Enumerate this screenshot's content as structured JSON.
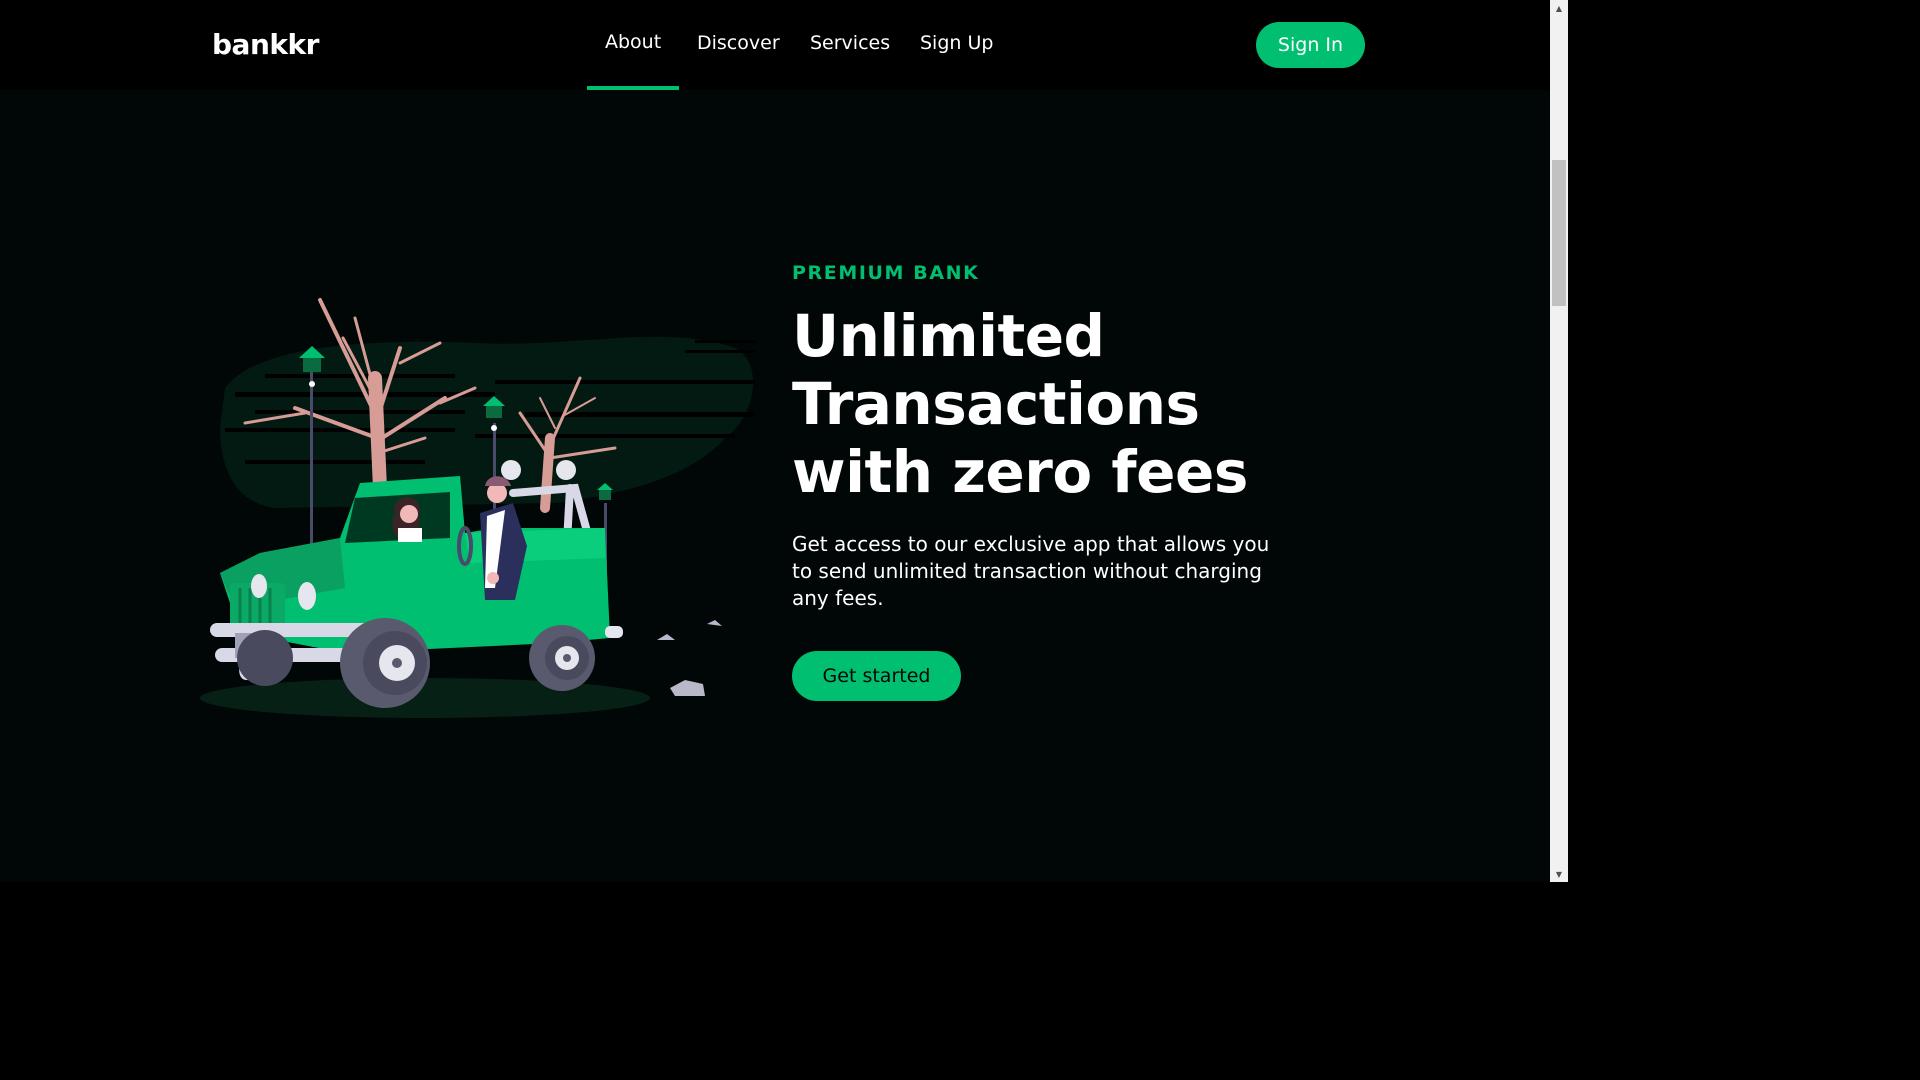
{
  "header": {
    "logo": "bankkr",
    "nav": [
      {
        "label": "About",
        "active": true
      },
      {
        "label": "Discover"
      },
      {
        "label": "Services"
      },
      {
        "label": "Sign Up"
      }
    ],
    "signin_label": "Sign In"
  },
  "hero": {
    "topline": "PREMIUM BANK",
    "heading": "Unlimited Transactions with zero fees",
    "subtitle": "Get access to our exclusive app that allows you to send unlimited transaction without charging any fees.",
    "cta_label": "Get started",
    "illustration": "green-jeep-with-couple-icon"
  },
  "colors": {
    "accent": "#01bf71",
    "background": "#010606",
    "header_background": "#000000",
    "text": "#ffffff"
  },
  "scrollbar": {
    "up_icon": "scroll-up-arrow-icon",
    "down_icon": "scroll-down-arrow-icon"
  }
}
